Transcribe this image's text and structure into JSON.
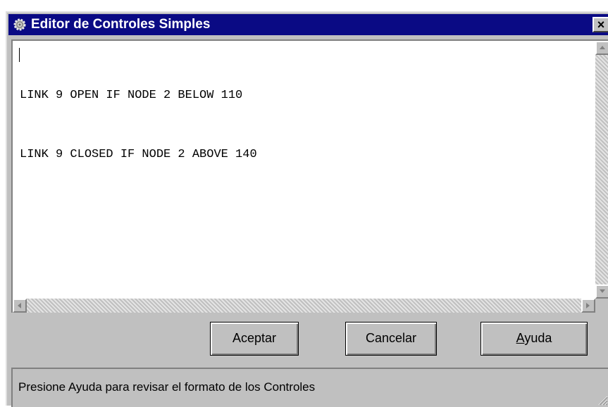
{
  "window": {
    "title": "Editor de Controles Simples",
    "close_label": "×"
  },
  "editor": {
    "lines": [
      "LINK 9 OPEN IF NODE 2 BELOW 110",
      "LINK 9 CLOSED IF NODE 2 ABOVE 140"
    ]
  },
  "buttons": {
    "accept_label": "Aceptar",
    "cancel_label": "Cancelar",
    "help_label_first": "A",
    "help_label_rest": "yuda"
  },
  "status": {
    "text": "Presione Ayuda para revisar el formato de los Controles"
  },
  "colors": {
    "titlebar": "#0a0a84",
    "face": "#c0c0c0"
  },
  "icons": [
    "gear-icon",
    "close-icon",
    "scroll-up-icon",
    "scroll-down-icon",
    "scroll-left-icon",
    "scroll-right-icon",
    "resize-grip-icon"
  ]
}
